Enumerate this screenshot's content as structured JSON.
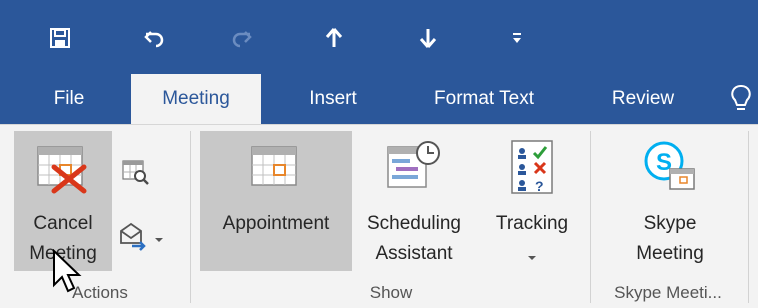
{
  "quick_access": {
    "save_icon": "save-icon",
    "undo_icon": "undo-icon",
    "redo_icon": "redo-icon",
    "up_icon": "previous-item-icon",
    "down_icon": "next-item-icon",
    "customize_icon": "customize-toolbar-icon"
  },
  "tabs": [
    {
      "label": "File"
    },
    {
      "label": "Meeting",
      "active": true
    },
    {
      "label": "Insert"
    },
    {
      "label": "Format Text"
    },
    {
      "label": "Review"
    }
  ],
  "tell_me_icon": "lightbulb-icon",
  "ribbon": {
    "actions": {
      "cancel_label_1": "Cancel",
      "cancel_label_2": "Meeting",
      "group_label": "Actions",
      "calendar_icon": "calendar-search-icon",
      "forward_icon": "forward-icon"
    },
    "show": {
      "appointment_label": "Appointment",
      "scheduling_label_1": "Scheduling",
      "scheduling_label_2": "Assistant",
      "tracking_label": "Tracking",
      "group_label": "Show"
    },
    "skype": {
      "label_1": "Skype",
      "label_2": "Meeting",
      "group_label": "Skype Meeti..."
    }
  },
  "colors": {
    "brand": "#2b579a",
    "ribbon_bg": "#f3f3f3",
    "selected_bg": "#c8c8c8",
    "cancel_red": "#d9371a",
    "calendar_orange": "#e8862a",
    "skype_blue": "#00aff0"
  }
}
